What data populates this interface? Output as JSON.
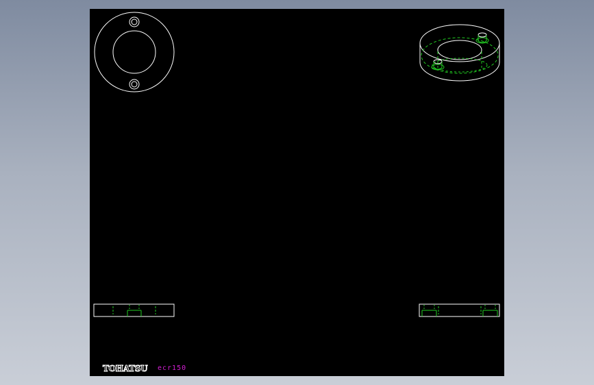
{
  "drawing": {
    "brand_logo": "TOHATSU",
    "drawing_code": "ecr150"
  },
  "colors": {
    "background_gradient_top": "#7f8ba0",
    "background_gradient_bottom": "#c9ced7",
    "sheet": "#000000",
    "outline": "#ffffff",
    "hidden_line": "#22cc22",
    "code_text": "#d61fd6"
  },
  "views": {
    "top_view": "top-view",
    "isometric_view": "isometric-view",
    "front_view": "front-view",
    "side_view": "side-view"
  }
}
